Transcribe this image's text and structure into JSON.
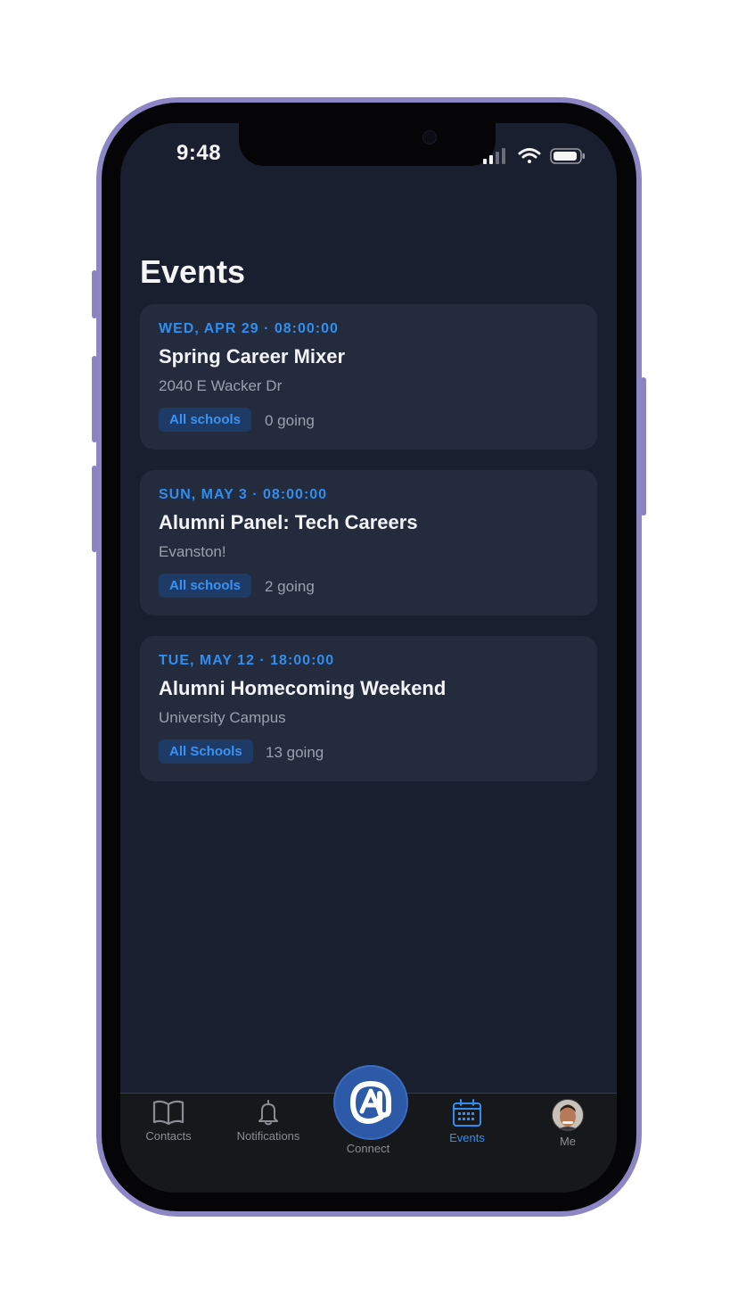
{
  "status_bar": {
    "time": "9:48"
  },
  "page": {
    "title": "Events"
  },
  "events": [
    {
      "date": "WED, APR 29 · 08:00:00",
      "title": "Spring Career Mixer",
      "location": "2040 E Wacker Dr",
      "badge": "All schools",
      "going": "0 going"
    },
    {
      "date": "SUN, MAY 3 · 08:00:00",
      "title": "Alumni Panel: Tech Careers",
      "location": "Evanston!",
      "badge": "All schools",
      "going": "2 going"
    },
    {
      "date": "TUE, MAY 12 · 18:00:00",
      "title": "Alumni Homecoming Weekend",
      "location": "University Campus",
      "badge": "All Schools",
      "going": "13 going"
    }
  ],
  "tabbar": {
    "contacts": "Contacts",
    "notifications": "Notifications",
    "connect": "Connect",
    "events": "Events",
    "me": "Me"
  },
  "colors": {
    "accent": "#2f8ef0",
    "background": "#1a1f2f",
    "card": "#232b3c",
    "frame": "#8c86c4"
  }
}
